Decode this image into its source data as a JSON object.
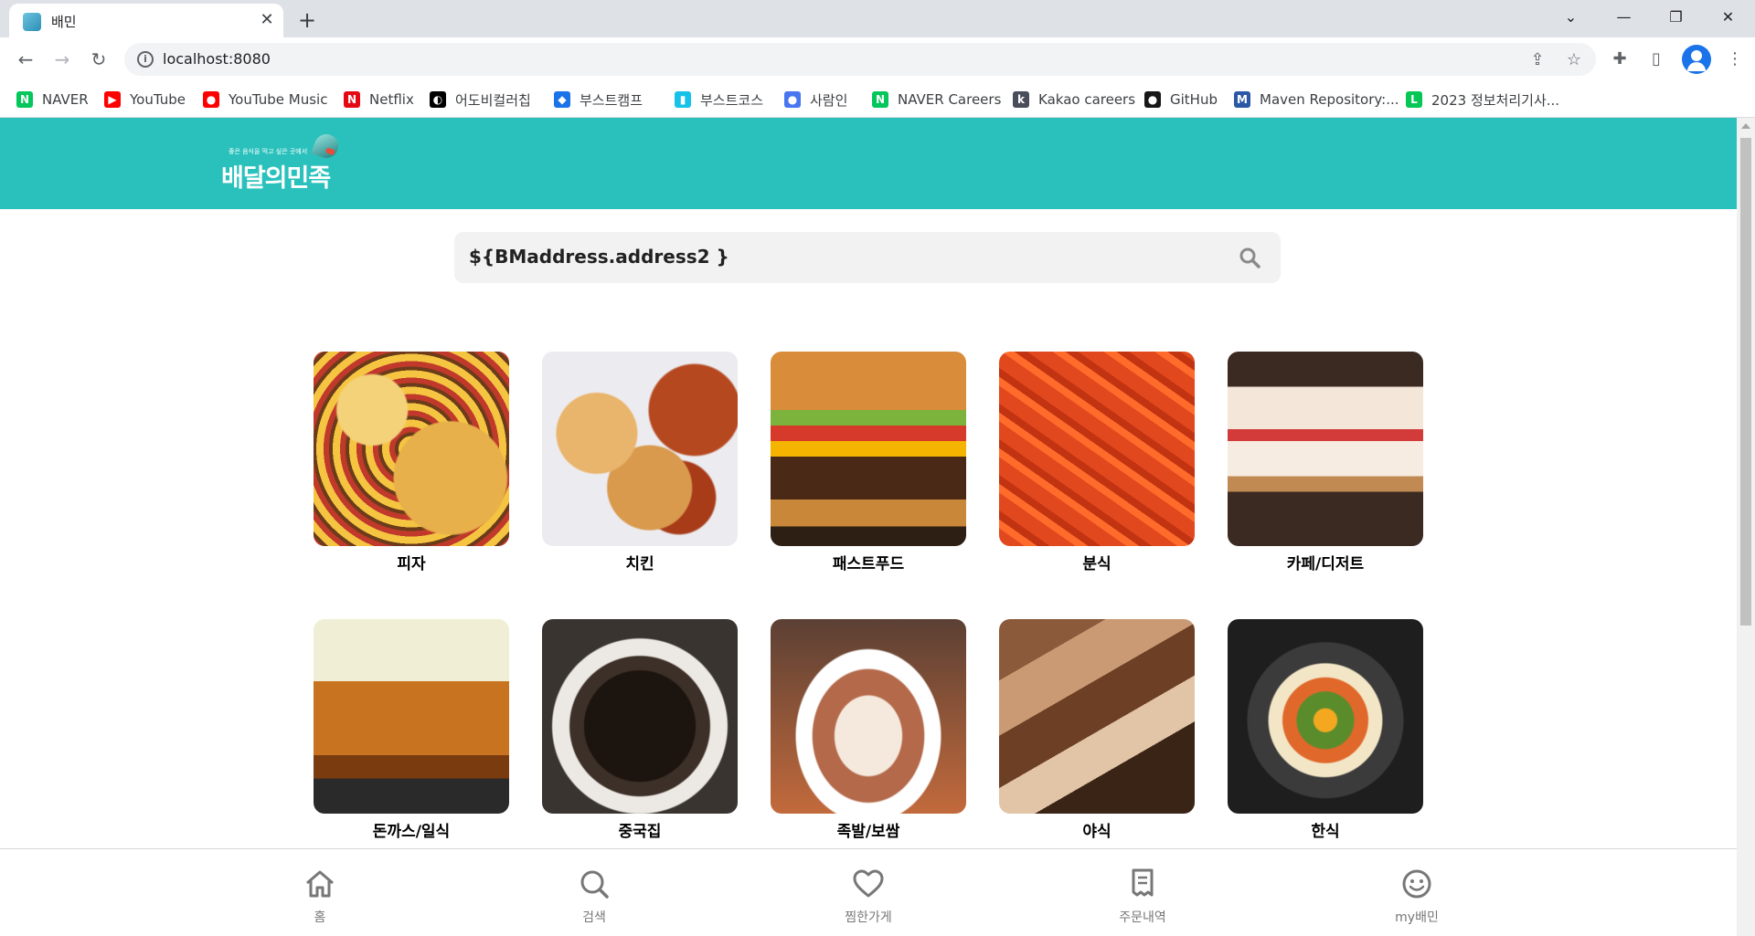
{
  "browser": {
    "tab": {
      "title": "배민"
    },
    "address_bar": {
      "url": "localhost:8080"
    },
    "bookmarks": [
      {
        "label": "NAVER",
        "icon": "naver-icon",
        "color": "#03c75a"
      },
      {
        "label": "YouTube",
        "icon": "youtube-icon",
        "color": "#ff0000"
      },
      {
        "label": "YouTube Music",
        "icon": "youtube-music-icon",
        "color": "#ff0000"
      },
      {
        "label": "Netflix",
        "icon": "netflix-icon",
        "color": "#e50914"
      },
      {
        "label": "어도비컬러칩",
        "icon": "adobe-color-icon",
        "color": "#000000"
      },
      {
        "label": "부스트캠프",
        "icon": "boostcamp-icon",
        "color": "#1a73e8"
      },
      {
        "label": "부스트코스",
        "icon": "boostcourse-icon",
        "color": "#16c2e8"
      },
      {
        "label": "사람인",
        "icon": "saramin-icon",
        "color": "#4876ef"
      },
      {
        "label": "NAVER Careers",
        "icon": "naver-careers-icon",
        "color": "#03c75a"
      },
      {
        "label": "Kakao careers",
        "icon": "kakao-careers-icon",
        "color": "#4a4e5b"
      },
      {
        "label": "GitHub",
        "icon": "github-icon",
        "color": "#181717"
      },
      {
        "label": "Maven Repository:...",
        "icon": "maven-icon",
        "color": "#2b58a5"
      },
      {
        "label": "2023 정보처리기사...",
        "icon": "line-icon",
        "color": "#06c755"
      }
    ]
  },
  "site": {
    "brand_color": "#2ac1bc",
    "logo": {
      "tagline": "좋은 음식을 먹고 싶은 곳에서",
      "name": "배달의민족"
    },
    "search": {
      "value": "${BMaddress.address2 }"
    },
    "categories": [
      {
        "label": "피자",
        "image": "pizza"
      },
      {
        "label": "치킨",
        "image": "chicken"
      },
      {
        "label": "패스트푸드",
        "image": "burger"
      },
      {
        "label": "분식",
        "image": "tteokbokki"
      },
      {
        "label": "카페/디저트",
        "image": "cake"
      },
      {
        "label": "돈까스/일식",
        "image": "tonkatsu"
      },
      {
        "label": "중국집",
        "image": "jjajangmyeon"
      },
      {
        "label": "족발/보쌈",
        "image": "jokbal"
      },
      {
        "label": "야식",
        "image": "night-snack"
      },
      {
        "label": "한식",
        "image": "bibimbap"
      }
    ],
    "bottom_nav": [
      {
        "label": "홈",
        "icon": "home-icon"
      },
      {
        "label": "검색",
        "icon": "search-icon"
      },
      {
        "label": "찜한가게",
        "icon": "heart-icon"
      },
      {
        "label": "주문내역",
        "icon": "receipt-icon"
      },
      {
        "label": "my배민",
        "icon": "smile-icon"
      }
    ]
  }
}
